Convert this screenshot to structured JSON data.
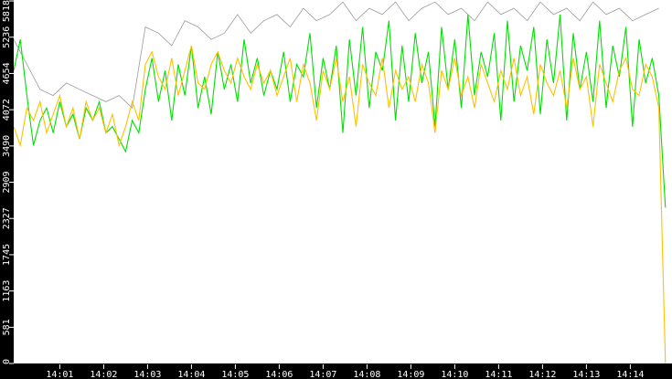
{
  "chart_data": {
    "type": "line",
    "title": "",
    "xlabel": "",
    "ylabel": "",
    "ylim": [
      0,
      5818
    ],
    "xlim_minutes_after_14_00": [
      -0.05,
      14.95
    ],
    "y_ticks": [
      "0",
      "581",
      "1163",
      "1745",
      "2327",
      "2909",
      "3490",
      "4072",
      "4654",
      "5236",
      "5818"
    ],
    "x_ticks": [
      {
        "label": "14:01",
        "minute": 1
      },
      {
        "label": "14:02",
        "minute": 2
      },
      {
        "label": "14:03",
        "minute": 3
      },
      {
        "label": "14:04",
        "minute": 4
      },
      {
        "label": "14:05",
        "minute": 5
      },
      {
        "label": "14:06",
        "minute": 6
      },
      {
        "label": "14:07",
        "minute": 7
      },
      {
        "label": "14:08",
        "minute": 8
      },
      {
        "label": "14:09",
        "minute": 9
      },
      {
        "label": "14:10",
        "minute": 10
      },
      {
        "label": "14:11",
        "minute": 11
      },
      {
        "label": "14:12",
        "minute": 12
      },
      {
        "label": "14:13",
        "minute": 13
      },
      {
        "label": "14:14",
        "minute": 14
      }
    ],
    "grid": false,
    "series": [
      {
        "name": "gray",
        "color": "#9a9a9a",
        "x_start": -0.05,
        "x_step": 0.3,
        "values": [
          5200,
          4800,
          4400,
          4300,
          4500,
          4400,
          4300,
          4200,
          4300,
          4100,
          5400,
          5300,
          5100,
          5500,
          5400,
          5200,
          5300,
          5600,
          5300,
          5500,
          5600,
          5400,
          5700,
          5500,
          5600,
          5800,
          5500,
          5700,
          5600,
          5800,
          5500,
          5700,
          5800,
          5600,
          5700,
          5500,
          5800,
          5600,
          5700,
          5500,
          5800,
          5600,
          5700,
          5500,
          5800,
          5600,
          5700,
          5500,
          5600,
          5700
        ]
      },
      {
        "name": "green",
        "color": "#00e000",
        "x_start": -0.05,
        "x_step": 0.15,
        "values": [
          4700,
          5200,
          4300,
          3500,
          3900,
          4100,
          3700,
          4200,
          3800,
          4000,
          3600,
          4100,
          3900,
          4200,
          3700,
          3800,
          3600,
          3400,
          3900,
          3700,
          4400,
          4900,
          4200,
          4700,
          3900,
          4800,
          4300,
          5100,
          4100,
          4600,
          4000,
          5000,
          4400,
          4800,
          4200,
          5200,
          4500,
          4900,
          4300,
          4700,
          4400,
          5000,
          4200,
          4800,
          4600,
          5300,
          4100,
          4900,
          4400,
          5100,
          3700,
          5200,
          4300,
          5400,
          4100,
          5000,
          4700,
          5500,
          3900,
          5100,
          4200,
          5300,
          4500,
          5000,
          3800,
          5400,
          4400,
          5200,
          4100,
          5600,
          4300,
          5000,
          4600,
          5300,
          3900,
          5500,
          4200,
          5100,
          4700,
          5400,
          4000,
          5200,
          4500,
          5600,
          3900,
          5300,
          4400,
          5000,
          4200,
          5500,
          4100,
          5100,
          4600,
          5400,
          3800,
          5200,
          4500,
          4900,
          4300,
          2500
        ]
      },
      {
        "name": "orange",
        "color": "#ffc000",
        "x_start": -0.05,
        "x_step": 0.15,
        "values": [
          3800,
          3500,
          4100,
          3900,
          4200,
          3700,
          4000,
          4300,
          3800,
          4100,
          3600,
          4200,
          3900,
          4100,
          3700,
          4000,
          3500,
          3800,
          4200,
          3900,
          4800,
          5000,
          4600,
          4400,
          4900,
          4300,
          4700,
          5100,
          4500,
          4400,
          4800,
          5000,
          4700,
          4500,
          4900,
          4600,
          4400,
          4800,
          4500,
          4700,
          4300,
          4600,
          4900,
          4200,
          4800,
          4500,
          3900,
          4700,
          4400,
          4900,
          4200,
          4600,
          3800,
          4800,
          4500,
          4300,
          4900,
          4100,
          4700,
          4400,
          4600,
          4200,
          4800,
          4500,
          3700,
          4700,
          4400,
          4900,
          4300,
          4600,
          4100,
          4800,
          4500,
          4200,
          4700,
          4400,
          4900,
          4300,
          4600,
          4000,
          4800,
          4500,
          4300,
          4700,
          4100,
          4900,
          4400,
          4600,
          3800,
          4800,
          4500,
          4200,
          4700,
          4900,
          4400,
          4300,
          4800,
          4600,
          4100,
          0
        ]
      }
    ]
  }
}
